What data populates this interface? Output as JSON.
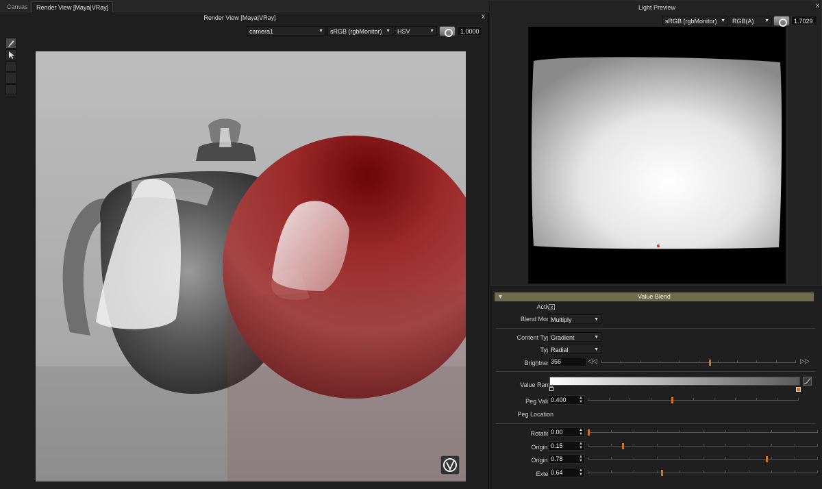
{
  "tabs": [
    {
      "label": "Canvas"
    },
    {
      "label": "Render View [Maya|VRay]"
    }
  ],
  "render_view": {
    "title": "Render View [Maya|VRay]",
    "camera": "camera1",
    "colorspace": "sRGB (rgbMonitor)",
    "channel": "HSV",
    "exposure": "1.0000",
    "close": "x"
  },
  "light_preview": {
    "title": "Light Preview",
    "colorspace": "sRGB (rgbMonitor)",
    "channel": "RGB(A)",
    "exposure": "1.7029",
    "close": "x"
  },
  "value_blend": {
    "header": "Value Blend",
    "active_label": "Active",
    "active_check": "x",
    "blend_mode_label": "Blend Mode",
    "blend_mode": "Multiply",
    "content_type_label": "Content Type",
    "content_type": "Gradient",
    "type_label": "Type",
    "type": "Radial",
    "brightness_label": "Brightness",
    "brightness": "356",
    "brightness_level": 0.56,
    "value_ramp_label": "Value Ramp",
    "peg_value_label": "Peg Value",
    "peg_value": "0.400",
    "peg_value_level": 0.4,
    "peg_location_label": "Peg Location",
    "rotation_label": "Rotation",
    "rotation": "0.00",
    "rotation_level": 0.0,
    "origin_x_label": "Origin X",
    "origin_x": "0.15",
    "origin_x_level": 0.15,
    "origin_y_label": "Origin Y",
    "origin_y": "0.78",
    "origin_y_level": 0.78,
    "extent_label": "Extent",
    "extent": "0.64",
    "extent_level": 0.32
  },
  "colors": {
    "accent": "#d2731e",
    "header": "#6e6b4e",
    "sphere": "#8a1a1a"
  }
}
